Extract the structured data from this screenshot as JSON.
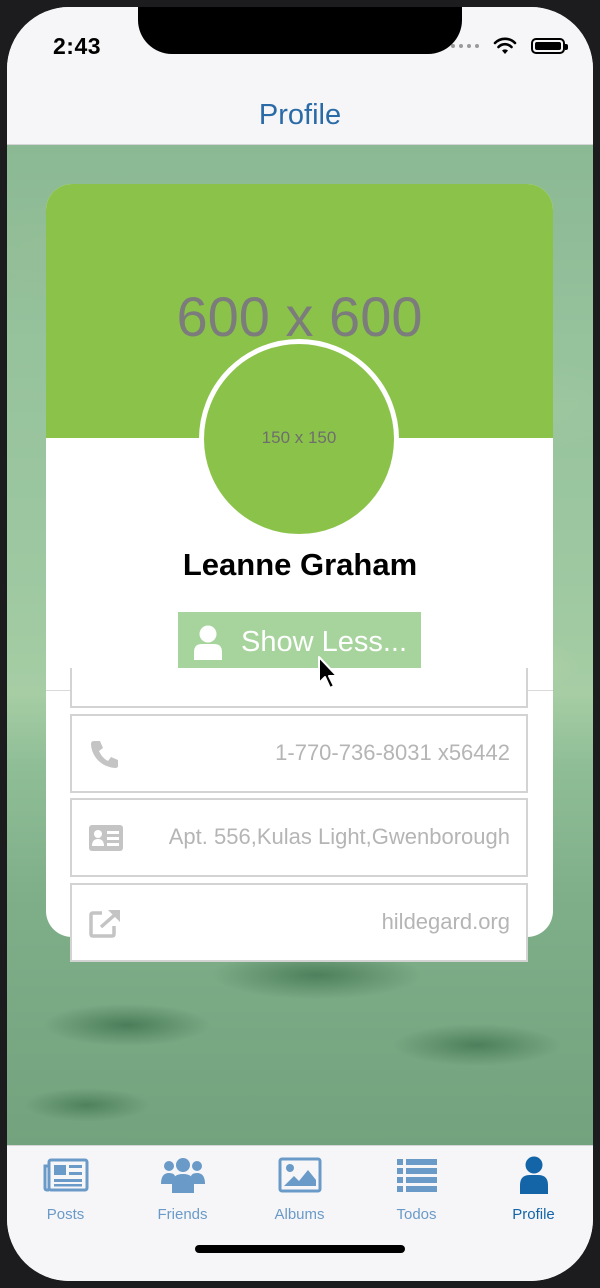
{
  "status_bar": {
    "time": "2:43"
  },
  "navbar": {
    "title": "Profile"
  },
  "profile": {
    "cover_placeholder": "600 x 600",
    "avatar_placeholder": "150 x 150",
    "name": "Leanne Graham",
    "toggle_button_label": "Show Less...",
    "details": [
      {
        "icon": "phone-icon",
        "value": "1-770-736-8031 x56442"
      },
      {
        "icon": "address-card-icon",
        "value": "Apt. 556,Kulas Light,Gwenborough"
      },
      {
        "icon": "external-link-icon",
        "value": "hildegard.org"
      }
    ]
  },
  "tab_bar": {
    "tabs": [
      {
        "label": "Posts",
        "icon": "newspaper-icon",
        "active": false
      },
      {
        "label": "Friends",
        "icon": "users-icon",
        "active": false
      },
      {
        "label": "Albums",
        "icon": "image-icon",
        "active": false
      },
      {
        "label": "Todos",
        "icon": "list-icon",
        "active": false
      },
      {
        "label": "Profile",
        "icon": "user-icon",
        "active": true
      }
    ]
  },
  "colors": {
    "accent": "#1464a8",
    "cover": "#8bc34a",
    "button": "#a6d49c",
    "inactive_tab": "#6a9ac8"
  }
}
